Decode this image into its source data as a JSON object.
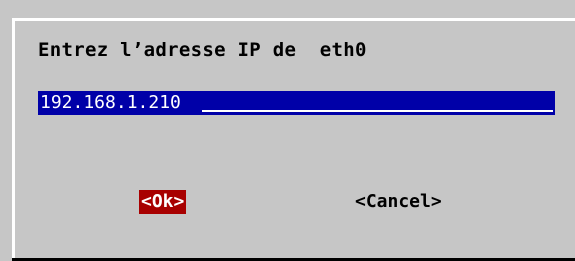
{
  "dialog": {
    "prompt": "Entrez l’adresse IP de  eth0",
    "input_value": "192.168.1.210",
    "ok_label": "<Ok>",
    "cancel_label": "<Cancel>"
  },
  "colors": {
    "background": "#c6c6c6",
    "input_background": "#0000a8",
    "input_text": "#ffffff",
    "ok_highlight": "#a80000",
    "frame_light": "#ffffff",
    "frame_dark": "#000000"
  }
}
